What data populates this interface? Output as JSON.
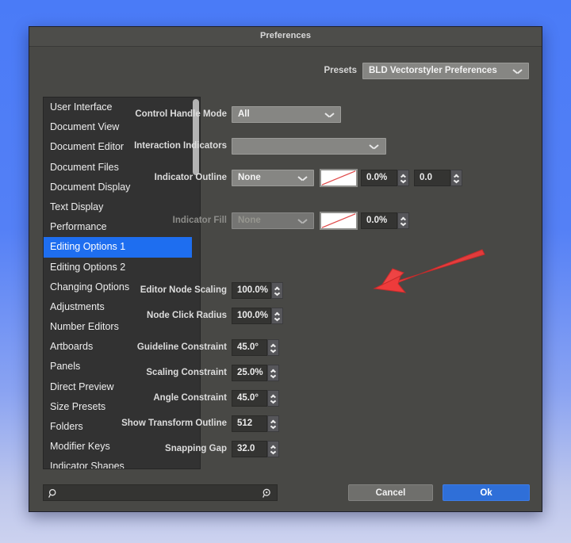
{
  "window": {
    "title": "Preferences"
  },
  "presets": {
    "label": "Presets",
    "value": "BLD Vectorstyler Preferences"
  },
  "sidebar": {
    "items": [
      {
        "label": "User Interface",
        "selected": false
      },
      {
        "label": "Document View",
        "selected": false
      },
      {
        "label": "Document Editor",
        "selected": false
      },
      {
        "label": "Document Files",
        "selected": false
      },
      {
        "label": "Document Display",
        "selected": false
      },
      {
        "label": "Text Display",
        "selected": false
      },
      {
        "label": "Performance",
        "selected": false
      },
      {
        "label": "Editing Options 1",
        "selected": true
      },
      {
        "label": "Editing Options 2",
        "selected": false
      },
      {
        "label": "Changing Options",
        "selected": false
      },
      {
        "label": "Adjustments",
        "selected": false
      },
      {
        "label": "Number Editors",
        "selected": false
      },
      {
        "label": "Artboards",
        "selected": false
      },
      {
        "label": "Panels",
        "selected": false
      },
      {
        "label": "Direct Preview",
        "selected": false
      },
      {
        "label": "Size Presets",
        "selected": false
      },
      {
        "label": "Folders",
        "selected": false
      },
      {
        "label": "Modifier Keys",
        "selected": false
      },
      {
        "label": "Indicator Shapes",
        "selected": false
      }
    ]
  },
  "form": {
    "control_handle_mode": {
      "label": "Control Handle Mode",
      "value": "All"
    },
    "interaction_indicators": {
      "label": "Interaction Indicators",
      "value": ""
    },
    "indicator_outline": {
      "label": "Indicator Outline",
      "value": "None",
      "swatch": "none-color-swatch",
      "opacity": "0.0%",
      "width": "0.0"
    },
    "indicator_fill": {
      "label": "Indicator Fill",
      "value": "None",
      "swatch": "none-color-swatch",
      "opacity": "0.0%"
    },
    "editor_node_scaling": {
      "label": "Editor Node Scaling",
      "value": "100.0%"
    },
    "node_click_radius": {
      "label": "Node Click Radius",
      "value": "100.0%"
    },
    "guideline_constraint": {
      "label": "Guideline Constraint",
      "value": "45.0°"
    },
    "scaling_constraint": {
      "label": "Scaling Constraint",
      "value": "25.0%"
    },
    "angle_constraint": {
      "label": "Angle Constraint",
      "value": "45.0°"
    },
    "show_transform_outline": {
      "label": "Show Transform Outline",
      "value": "512"
    },
    "snapping_gap": {
      "label": "Snapping Gap",
      "value": "32.0"
    }
  },
  "search": {
    "value": "",
    "placeholder": "",
    "left_icon": "search-icon",
    "right_icon": "search-zoom-icon"
  },
  "buttons": {
    "cancel": "Cancel",
    "ok": "Ok"
  },
  "annotation": {
    "arrow": "red-arrow-pointing-to-node-click-radius-stepper",
    "color": "#ee3b3b"
  },
  "colors": {
    "accent_blue": "#1e6ef0",
    "ok_button": "#2f6fd8",
    "dialog_bg": "#484845",
    "sidebar_bg": "#323232",
    "desktop_top": "#4a7bf7",
    "desktop_bottom": "#ccd2ef"
  }
}
